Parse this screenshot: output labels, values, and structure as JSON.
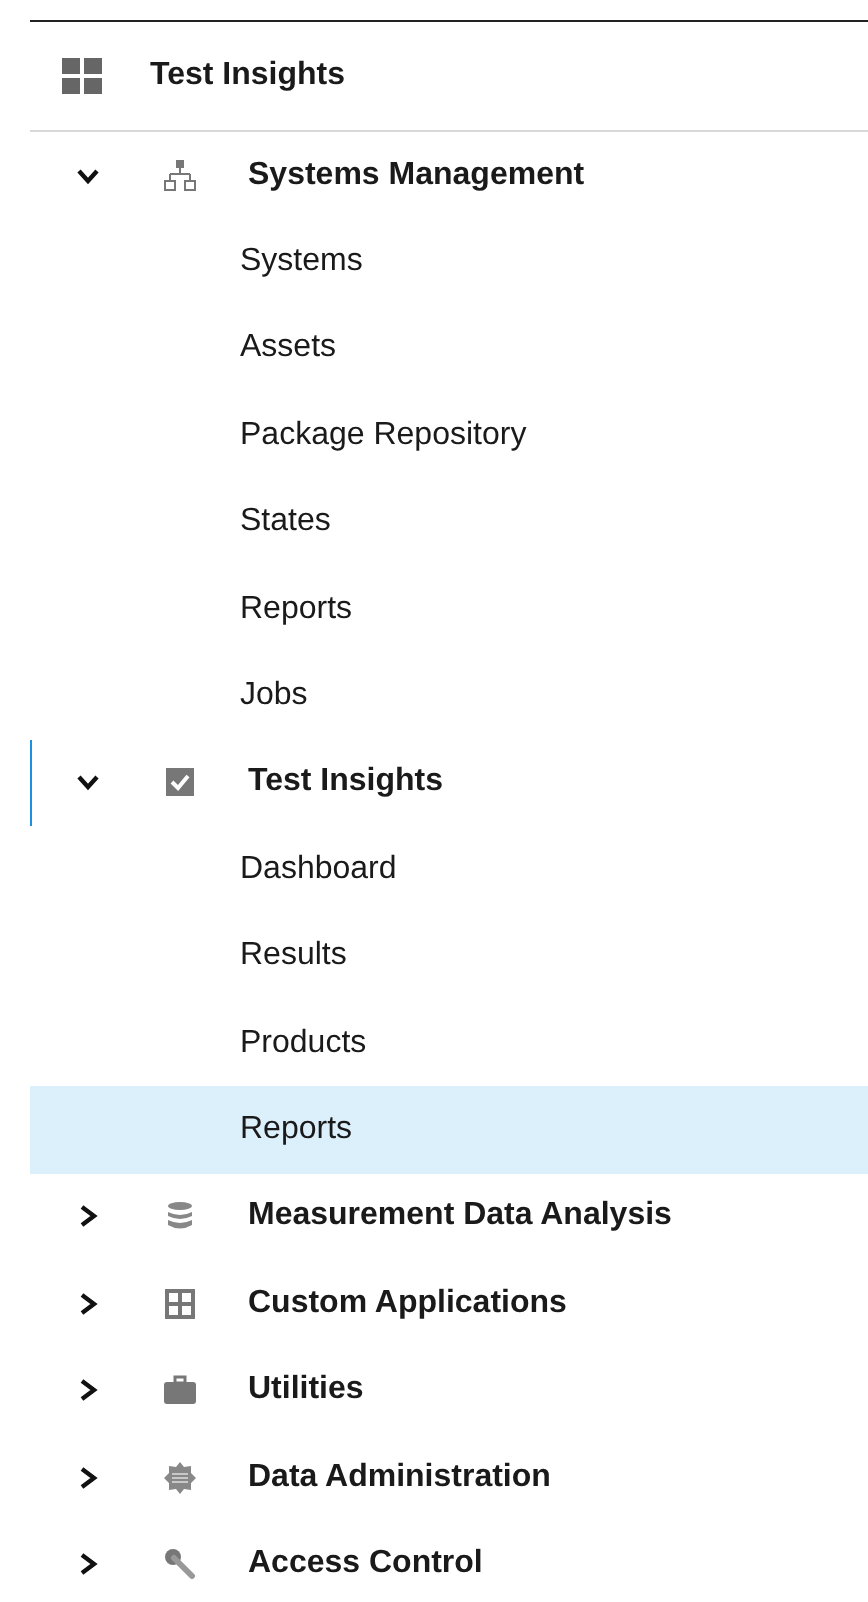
{
  "header": {
    "title": "Test Insights"
  },
  "sections": [
    {
      "label": "Systems Management",
      "expanded": true,
      "current": false,
      "children": [
        {
          "label": "Systems",
          "selected": false
        },
        {
          "label": "Assets",
          "selected": false
        },
        {
          "label": "Package Repository",
          "selected": false
        },
        {
          "label": "States",
          "selected": false
        },
        {
          "label": "Reports",
          "selected": false
        },
        {
          "label": "Jobs",
          "selected": false
        }
      ]
    },
    {
      "label": "Test Insights",
      "expanded": true,
      "current": true,
      "children": [
        {
          "label": "Dashboard",
          "selected": false
        },
        {
          "label": "Results",
          "selected": false
        },
        {
          "label": "Products",
          "selected": false
        },
        {
          "label": "Reports",
          "selected": true
        }
      ]
    },
    {
      "label": "Measurement Data Analysis",
      "expanded": false,
      "current": false
    },
    {
      "label": "Custom Applications",
      "expanded": false,
      "current": false
    },
    {
      "label": "Utilities",
      "expanded": false,
      "current": false
    },
    {
      "label": "Data Administration",
      "expanded": false,
      "current": false
    },
    {
      "label": "Access Control",
      "expanded": false,
      "current": false
    }
  ]
}
